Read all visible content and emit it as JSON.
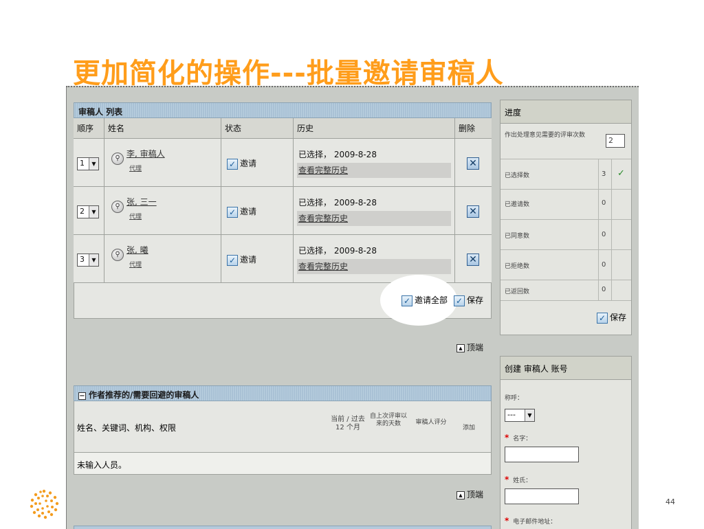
{
  "slide": {
    "title": "更加简化的操作---批量邀请审稿人",
    "page_number": "44"
  },
  "reviewer_list": {
    "panel_title": "审稿人 列表",
    "columns": [
      "顺序",
      "姓名",
      "状态",
      "历史",
      "删除"
    ],
    "rows": [
      {
        "order": "1",
        "name": "李, 审稿人",
        "proxy": "代理",
        "status": "邀请",
        "history_status": "已选择，",
        "history_date": "2009-8-28",
        "history_link": "查看完整历史"
      },
      {
        "order": "2",
        "name": "张, 三一",
        "proxy": "代理",
        "status": "邀请",
        "history_status": "已选择，",
        "history_date": "2009-8-28",
        "history_link": "查看完整历史"
      },
      {
        "order": "3",
        "name": "张, 曦",
        "proxy": "代理",
        "status": "邀请",
        "history_status": "已选择，",
        "history_date": "2009-8-28",
        "history_link": "查看完整历史"
      }
    ],
    "invite_all_label": "邀请全部",
    "save_label": "保存",
    "top_label": "顶端"
  },
  "progress": {
    "title": "进度",
    "required_label": "作出处理意见需要的评审次数",
    "required_value": "2",
    "rows": [
      {
        "label": "已选择数",
        "value": "3",
        "check": "✓"
      },
      {
        "label": "已邀请数",
        "value": "0"
      },
      {
        "label": "已同意数",
        "value": "0"
      },
      {
        "label": "已拒绝数",
        "value": "0"
      },
      {
        "label": "已返回数",
        "value": "0"
      }
    ],
    "save_label": "保存"
  },
  "recommended": {
    "panel_title": "作者推荐的/需要回避的审稿人",
    "collapse_glyph": "−",
    "columns": {
      "name": "姓名、关键词、机构、权限",
      "current": "当前 / 过去 12 个月",
      "days": "自上次评审以来的天数",
      "score": "审稿人评分",
      "add": "添加"
    },
    "empty_text": "未输入人员。",
    "top_label": "顶端"
  },
  "create_account": {
    "title": "创建 审稿人 账号",
    "salutation_label": "称呼：",
    "salutation_value": "---",
    "first_name_label": "名字：",
    "last_name_label": "姓氏：",
    "email_label": "电子邮件地址：",
    "required_mark": "*"
  }
}
